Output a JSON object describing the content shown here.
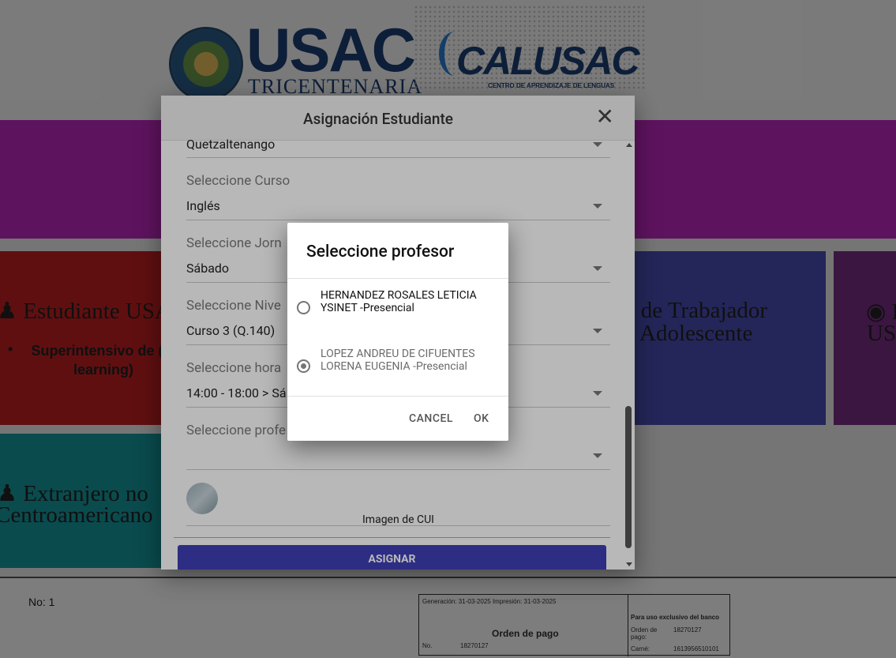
{
  "header": {
    "usac_logo_text": "USAC",
    "usac_logo_sub": "TRICENTENARIA",
    "calusac_logo_text": "CALUSAC",
    "calusac_logo_sub": "CENTRO DE APRENDIZAJE DE LENGUAS"
  },
  "cards": {
    "student_usac": "Estudiante USA",
    "student_usac_bullet": "Superintensivo de (e-learning)",
    "foreigner_line1": "Extranjero no",
    "foreigner_line2": "Centroamericano",
    "worker_line1": "o de Trabajador",
    "worker_line2": "Adolescente",
    "right_line1": "E",
    "right_line2": "US"
  },
  "footer": {
    "number_label": "No: 1",
    "receipt": {
      "dates": "Generación: 31-03-2025   Impresión: 31-03-2025",
      "title": "Orden de pago",
      "no_label": "No.",
      "no_value": "18270127",
      "bank_note": "Para uso exclusivo del banco",
      "order_label": "Orden de pago:",
      "order_value": "18270127",
      "carne_label": "Carné:",
      "carne_value": "1613956510101"
    }
  },
  "modal": {
    "title": "Asignación Estudiante",
    "fields": [
      {
        "label": "",
        "value": "Quetzaltenango"
      },
      {
        "label": "Seleccione Curso",
        "value": "Inglés"
      },
      {
        "label": "Seleccione Jorn",
        "value": "Sábado"
      },
      {
        "label": "Seleccione Nive",
        "value": "Curso 3 (Q.140)"
      },
      {
        "label": "Seleccione hora",
        "value": "14:00 - 18:00 > Sá"
      },
      {
        "label": "Seleccione profe",
        "value": ""
      }
    ],
    "cui_caption": "Imagen de CUI",
    "assign_button": "ASIGNAR"
  },
  "dialog": {
    "title": "Seleccione profesor",
    "options": [
      {
        "label": "HERNANDEZ ROSALES LETICIA YSINET -Presencial",
        "selected": false
      },
      {
        "label": "LOPEZ ANDREU DE CIFUENTES LORENA EUGENIA -Presencial",
        "selected": true
      }
    ],
    "cancel_button": "CANCEL",
    "ok_button": "OK"
  },
  "colors": {
    "banner": "#c228c2",
    "card_red": "#c51f22",
    "card_teal": "#159aa0",
    "card_blue": "#4b4fb7",
    "card_purple": "#7b2f86",
    "assign_button": "#3f3fb8"
  }
}
